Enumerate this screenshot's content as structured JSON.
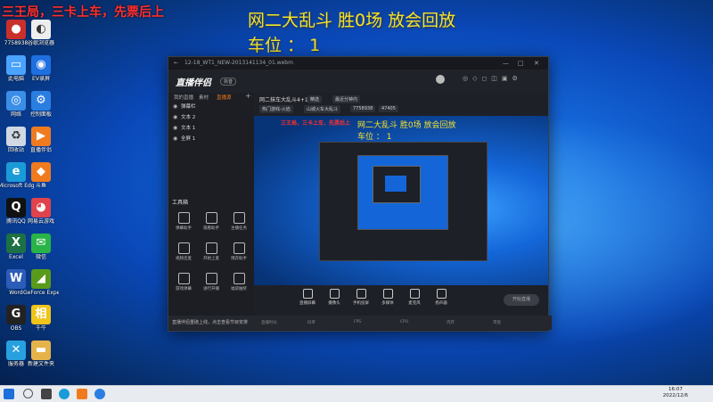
{
  "overlay": {
    "red_text": "三王局，三卡上车，先票后上",
    "yellow_line1": "网二大乱斗 胜0场    放会回放",
    "yellow_line2": "车位 ： 1"
  },
  "desktop_icons": [
    {
      "label": "7758938",
      "icon": "app-icon",
      "color": "#c9302c",
      "glyph": "●"
    },
    {
      "label": "谷歌浏览器",
      "icon": "browser-icon",
      "color": "#eee",
      "glyph": "◐"
    },
    {
      "label": "此电脑",
      "icon": "computer-icon",
      "color": "#4aa3ff",
      "glyph": "▭"
    },
    {
      "label": "EV录屏",
      "icon": "recorder-icon",
      "color": "#1f6fe0",
      "glyph": "◉"
    },
    {
      "label": "网络",
      "icon": "network-icon",
      "color": "#3b8ee8",
      "glyph": "◎"
    },
    {
      "label": "控制面板",
      "icon": "control-panel-icon",
      "color": "#2a7ee0",
      "glyph": "⚙"
    },
    {
      "label": "回收站",
      "icon": "recycle-bin-icon",
      "color": "#cfd8e3",
      "glyph": "♻"
    },
    {
      "label": "直播伴侣",
      "icon": "live-companion-icon",
      "color": "#f07b1f",
      "glyph": "▶"
    },
    {
      "label": "Microsoft Edge",
      "icon": "edge-icon",
      "color": "#1a9bd7",
      "glyph": "e"
    },
    {
      "label": "斗鱼",
      "icon": "douyu-icon",
      "color": "#f07b1f",
      "glyph": "◆"
    },
    {
      "label": "腾讯QQ",
      "icon": "qq-icon",
      "color": "#111",
      "glyph": "Q"
    },
    {
      "label": "网易云游戏",
      "icon": "game-icon",
      "color": "#e0434b",
      "glyph": "◕"
    },
    {
      "label": "Excel",
      "icon": "excel-icon",
      "color": "#1d7044",
      "glyph": "X"
    },
    {
      "label": "微信",
      "icon": "wechat-icon",
      "color": "#28b446",
      "glyph": "✉"
    },
    {
      "label": "Word",
      "icon": "word-icon",
      "color": "#2b5cb8",
      "glyph": "W"
    },
    {
      "label": "GeForce Experience",
      "icon": "nvidia-icon",
      "color": "#5a9a1a",
      "glyph": "◢"
    },
    {
      "label": "OBS",
      "icon": "obs-icon",
      "color": "#222",
      "glyph": "G"
    },
    {
      "label": "千牛",
      "icon": "qianniu-icon",
      "color": "#f0c419",
      "glyph": "相"
    },
    {
      "label": "服务器",
      "icon": "tool-icon",
      "color": "#27a0e0",
      "glyph": "✕"
    },
    {
      "label": "新建文件夹",
      "icon": "folder-icon",
      "color": "#e6b34a",
      "glyph": "▬"
    }
  ],
  "window": {
    "title": "12-18_WT1_NEW-2013141134_01.webm",
    "logo": "直播伴侣",
    "logo_badge": "抖音",
    "left_tabs": [
      "我的直播",
      "素材",
      "直播源"
    ],
    "scenes": [
      "弹幕栏",
      "文本 2",
      "文本 1",
      "全屏 1"
    ],
    "tools_title": "工具箱",
    "tools": [
      "弹幕助手",
      "观看助手",
      "主播任务",
      "视频连麦",
      "开始上麦",
      "博弈助手",
      "游戏弹幕",
      "进行开播",
      "福袋抽奖"
    ],
    "ad_text": "直播伴侣重磅上线，点击查看节目安排",
    "stream_title": "网二抹车大乱斗4+1",
    "chips": [
      "精选",
      "最近分钟内",
      "热门游戏-火焰",
      "山城火车大乱斗",
      "7758938",
      "47405"
    ],
    "bottom_items": [
      "直播屏幕",
      "摄像头",
      "手机投屏",
      "多媒体",
      "麦克风",
      "扬声器"
    ],
    "live_button": "开始直播",
    "status": [
      "直播时长",
      "码率",
      "FPS",
      "CPU",
      "内存",
      "带宽"
    ]
  },
  "taskbar": {
    "time": "16:07",
    "date": "2022/12/6"
  }
}
